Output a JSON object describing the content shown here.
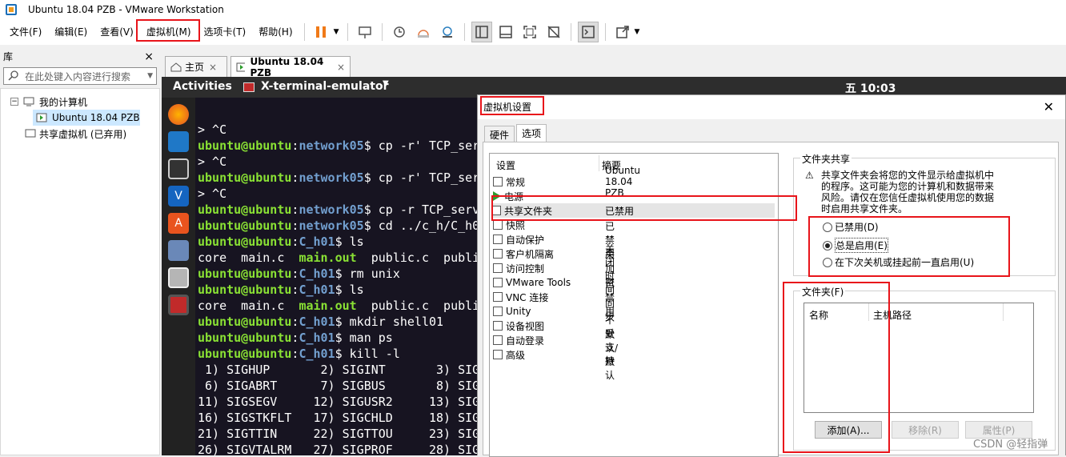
{
  "window": {
    "title": "Ubuntu 18.04 PZB - VMware Workstation"
  },
  "menu": {
    "items": [
      "文件(F)",
      "编辑(E)",
      "查看(V)",
      "虚拟机(M)",
      "选项卡(T)",
      "帮助(H)"
    ]
  },
  "library": {
    "title": "库",
    "search_placeholder": "在此处键入内容进行搜索",
    "tree": {
      "my_computer": "我的计算机",
      "vm": "Ubuntu 18.04 PZB",
      "shared": "共享虚拟机 (已弃用)"
    }
  },
  "tabs": {
    "home": "主页",
    "vm": "Ubuntu 18.04 PZB"
  },
  "gnome": {
    "activities": "Activities",
    "app": "X-terminal-emulator",
    "clock": "五 10:03"
  },
  "terminal": {
    "lines": [
      {
        "parts": [
          {
            "t": "> ^C",
            "c": ""
          }
        ]
      },
      {
        "parts": [
          {
            "t": "ubuntu@ubuntu",
            "c": "g"
          },
          {
            "t": ":",
            "c": ""
          },
          {
            "t": "network05",
            "c": "b"
          },
          {
            "t": "$ cp -r' TCP_ser",
            "c": ""
          }
        ]
      },
      {
        "parts": [
          {
            "t": "> ^C",
            "c": ""
          }
        ]
      },
      {
        "parts": [
          {
            "t": "ubuntu@ubuntu",
            "c": "g"
          },
          {
            "t": ":",
            "c": ""
          },
          {
            "t": "network05",
            "c": "b"
          },
          {
            "t": "$ cp -r' TCP_ser",
            "c": ""
          }
        ]
      },
      {
        "parts": [
          {
            "t": "> ^C",
            "c": ""
          }
        ]
      },
      {
        "parts": [
          {
            "t": "ubuntu@ubuntu",
            "c": "g"
          },
          {
            "t": ":",
            "c": ""
          },
          {
            "t": "network05",
            "c": "b"
          },
          {
            "t": "$ cp -r TCP_serv",
            "c": ""
          }
        ]
      },
      {
        "parts": [
          {
            "t": "ubuntu@ubuntu",
            "c": "g"
          },
          {
            "t": ":",
            "c": ""
          },
          {
            "t": "network05",
            "c": "b"
          },
          {
            "t": "$ cd ../c_h/C_h0",
            "c": ""
          }
        ]
      },
      {
        "parts": [
          {
            "t": "ubuntu@ubuntu",
            "c": "g"
          },
          {
            "t": ":",
            "c": ""
          },
          {
            "t": "C_h01",
            "c": "b"
          },
          {
            "t": "$ ls",
            "c": ""
          }
        ]
      },
      {
        "parts": [
          {
            "t": "core  main.c  ",
            "c": ""
          },
          {
            "t": "main.out",
            "c": "g"
          },
          {
            "t": "  public.c  publi",
            "c": ""
          }
        ]
      },
      {
        "parts": [
          {
            "t": "ubuntu@ubuntu",
            "c": "g"
          },
          {
            "t": ":",
            "c": ""
          },
          {
            "t": "C_h01",
            "c": "b"
          },
          {
            "t": "$ rm unix",
            "c": ""
          }
        ]
      },
      {
        "parts": [
          {
            "t": "ubuntu@ubuntu",
            "c": "g"
          },
          {
            "t": ":",
            "c": ""
          },
          {
            "t": "C_h01",
            "c": "b"
          },
          {
            "t": "$ ls",
            "c": ""
          }
        ]
      },
      {
        "parts": [
          {
            "t": "core  main.c  ",
            "c": ""
          },
          {
            "t": "main.out",
            "c": "g"
          },
          {
            "t": "  public.c  publi",
            "c": ""
          }
        ]
      },
      {
        "parts": [
          {
            "t": "ubuntu@ubuntu",
            "c": "g"
          },
          {
            "t": ":",
            "c": ""
          },
          {
            "t": "C_h01",
            "c": "b"
          },
          {
            "t": "$ mkdir shell01",
            "c": ""
          }
        ]
      },
      {
        "parts": [
          {
            "t": "ubuntu@ubuntu",
            "c": "g"
          },
          {
            "t": ":",
            "c": ""
          },
          {
            "t": "C_h01",
            "c": "b"
          },
          {
            "t": "$ man ps",
            "c": ""
          }
        ]
      },
      {
        "parts": [
          {
            "t": "ubuntu@ubuntu",
            "c": "g"
          },
          {
            "t": ":",
            "c": ""
          },
          {
            "t": "C_h01",
            "c": "b"
          },
          {
            "t": "$ kill -l",
            "c": ""
          }
        ]
      },
      {
        "parts": [
          {
            "t": " 1) SIGHUP       2) SIGINT       3) SIG",
            "c": ""
          }
        ]
      },
      {
        "parts": [
          {
            "t": " 6) SIGABRT      7) SIGBUS       8) SIG",
            "c": ""
          }
        ]
      },
      {
        "parts": [
          {
            "t": "11) SIGSEGV     12) SIGUSR2     13) SIG",
            "c": ""
          }
        ]
      },
      {
        "parts": [
          {
            "t": "16) SIGSTKFLT   17) SIGCHLD     18) SIG",
            "c": ""
          }
        ]
      },
      {
        "parts": [
          {
            "t": "21) SIGTTIN     22) SIGTTOU     23) SIG",
            "c": ""
          }
        ]
      },
      {
        "parts": [
          {
            "t": "26) SIGVTALRM   27) SIGPROF     28) SIG",
            "c": ""
          }
        ]
      }
    ]
  },
  "dialog": {
    "title": "虚拟机设置",
    "tabs": [
      "硬件",
      "选项"
    ],
    "columns": {
      "setting": "设置",
      "summary": "摘要"
    },
    "settings": [
      {
        "name": "常规",
        "value": "Ubuntu 18.04 PZB"
      },
      {
        "name": "电源",
        "value": ""
      },
      {
        "name": "共享文件夹",
        "value": "已禁用"
      },
      {
        "name": "快照",
        "value": ""
      },
      {
        "name": "自动保护",
        "value": "已禁用"
      },
      {
        "name": "客户机隔离",
        "value": ""
      },
      {
        "name": "访问控制",
        "value": "未加密"
      },
      {
        "name": "VMware Tools",
        "value": "关闭时间同步"
      },
      {
        "name": "VNC 连接",
        "value": "已禁用"
      },
      {
        "name": "Unity",
        "value": ""
      },
      {
        "name": "设备视图",
        "value": ""
      },
      {
        "name": "自动登录",
        "value": "不受支持"
      },
      {
        "name": "高级",
        "value": "默认/默认"
      }
    ],
    "share_group": {
      "title": "文件夹共享",
      "warning": "共享文件夹会将您的文件显示给虚拟机中的程序。这可能为您的计算机和数据带来风险。请仅在您信任虚拟机使用您的数据时启用共享文件夹。",
      "options": [
        "已禁用(D)",
        "总是启用(E)",
        "在下次关机或挂起前一直启用(U)"
      ]
    },
    "folder_group": {
      "title": "文件夹(F)",
      "col_name": "名称",
      "col_path": "主机路径",
      "add": "添加(A)...",
      "remove": "移除(R)",
      "props": "属性(P)"
    }
  },
  "watermark": "CSDN @轻指弹"
}
